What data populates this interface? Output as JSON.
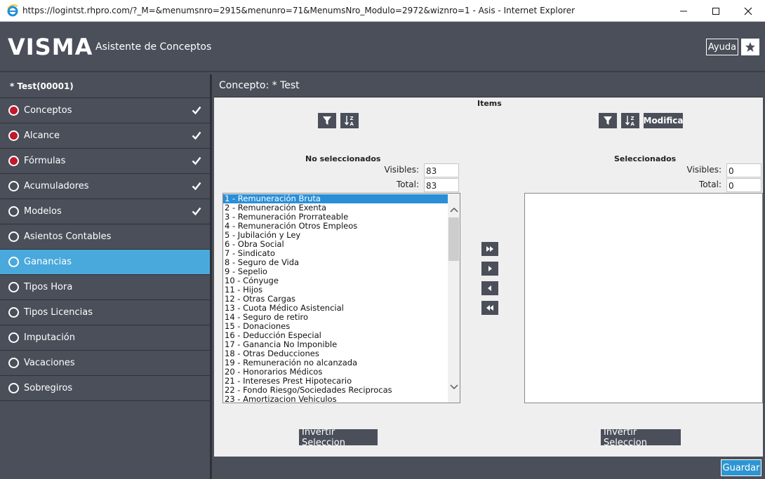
{
  "window": {
    "title": "https://logintst.rhpro.com/?_M=&menumsnro=2915&menunro=71&MenumsNro_Modulo=2972&wiznro=1 - Asis - Internet Explorer",
    "min_glyph": "—",
    "max_glyph": "☐",
    "close_glyph": "✕"
  },
  "header": {
    "logo": "VISMA",
    "app_title": "Asistente de Conceptos",
    "help_label": "Ayuda"
  },
  "sidebar": {
    "title": "* Test(00001)",
    "items": [
      {
        "label": "Conceptos",
        "done": true,
        "checked": true
      },
      {
        "label": "Alcance",
        "done": true,
        "checked": true
      },
      {
        "label": "Fórmulas",
        "done": true,
        "checked": true
      },
      {
        "label": "Acumuladores",
        "done": false,
        "checked": true
      },
      {
        "label": "Modelos",
        "done": false,
        "checked": true
      },
      {
        "label": "Asientos Contables",
        "done": false,
        "checked": false
      },
      {
        "label": "Ganancias",
        "done": false,
        "checked": false,
        "active": true
      },
      {
        "label": "Tipos Hora",
        "done": false,
        "checked": false
      },
      {
        "label": "Tipos Licencias",
        "done": false,
        "checked": false
      },
      {
        "label": "Imputación",
        "done": false,
        "checked": false
      },
      {
        "label": "Vacaciones",
        "done": false,
        "checked": false
      },
      {
        "label": "Sobregiros",
        "done": false,
        "checked": false
      }
    ]
  },
  "main": {
    "heading": "Concepto: * Test",
    "items_label": "Items",
    "modify_label": "Modifica",
    "sort_glyph": "↓ᶻₐ",
    "left": {
      "title": "No seleccionados",
      "visibles_label": "Visibles:",
      "visibles_value": "83",
      "total_label": "Total:",
      "total_value": "83",
      "selected_index": 0,
      "items": [
        "1 - Remuneración Bruta",
        "2 - Remuneración Exenta",
        "3 - Remuneración Prorrateable",
        "4 - Remuneración Otros Empleos",
        "5 - Jubilación y Ley",
        "6 - Obra Social",
        "7 - Sindicato",
        "8 - Seguro de Vida",
        "9 - Sepelio",
        "10 - Cónyuge",
        "11 - Hijos",
        "12 - Otras Cargas",
        "13 - Cuota Médico Asistencial",
        "14 - Seguro de retiro",
        "15 - Donaciones",
        "16 - Deducción Especial",
        "17 - Ganancia No Imponible",
        "18 - Otras Deducciones",
        "19 - Remuneración no alcanzada",
        "20 - Honorarios Médicos",
        "21 - Intereses Prest Hipotecario",
        "22 - Fondo Riesgo/Sociedades Reciprocas",
        "23 - Amortizacion Vehiculos"
      ],
      "invert_label": "Invertir Seleccion"
    },
    "right": {
      "title": "Seleccionados",
      "visibles_label": "Visibles:",
      "visibles_value": "0",
      "total_label": "Total:",
      "total_value": "0",
      "items": [],
      "invert_label": "Invertir Seleccion"
    },
    "save_label": "Guardar"
  },
  "colors": {
    "chrome": "#4a4f5a",
    "active": "#4aa9dc",
    "done_dot": "#c0182c",
    "save": "#2d95d1"
  }
}
